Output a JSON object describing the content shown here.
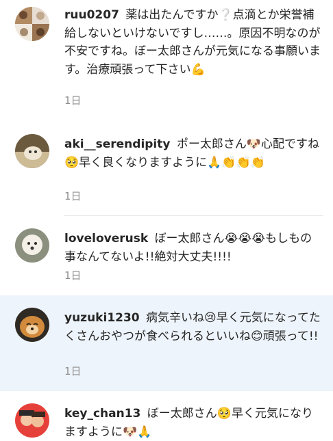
{
  "comments": [
    {
      "username": "ruu0207",
      "text": "薬は出たんですか❔点滴とか栄誉補給しないといけないですし……。原因不明なのが不安ですね。ぼー太郎さんが元気になる事願います。治療頑張って下さい💪",
      "time": "1日",
      "avatar_icon": "dog-collage-avatar"
    },
    {
      "username": "aki__serendipity",
      "text": "ポー太郎さん🐶心配ですね🥺早く良くなりますように🙏👏👏👏",
      "time": "1日",
      "avatar_icon": "dog-on-blanket-avatar"
    },
    {
      "username": "loveloverusk",
      "text": "ぼー太郎さん😭😭😭もしもの事なんてないよ!!絶対大丈夫!!!!",
      "time": "1日",
      "avatar_icon": "white-poodle-avatar"
    },
    {
      "username": "yuzuki1230",
      "text": "病気辛いね😢早く元気になってたくさんおやつが食べられるといいね😊頑張って!!",
      "time": "1日",
      "avatar_icon": "pomeranian-avatar"
    },
    {
      "username": "key_chan13",
      "text": "ぼー太郎さん🥺早く元気になりますように🐶🙏",
      "time": "",
      "avatar_icon": "children-avatar"
    }
  ],
  "colors": {
    "username": "#262626",
    "text": "#262626",
    "time": "#8e8e8e",
    "highlight_bg": "#eef4fb"
  }
}
